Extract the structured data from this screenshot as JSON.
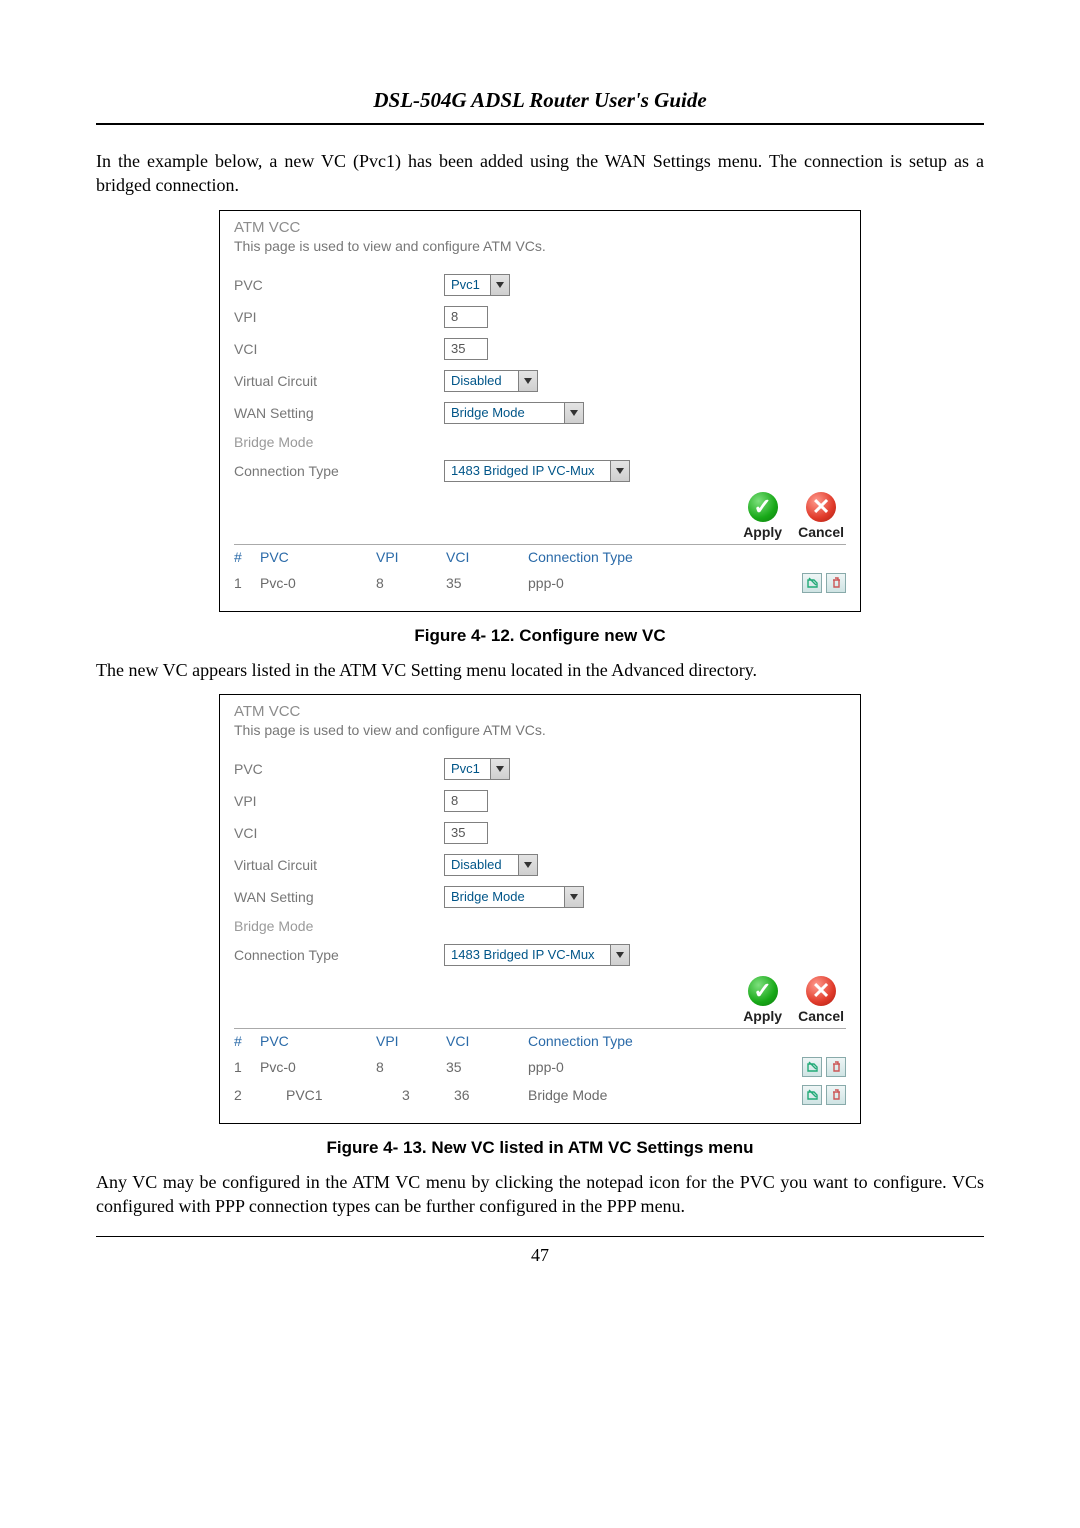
{
  "header": {
    "title": "DSL-504G ADSL Router User's Guide"
  },
  "para1": "In the example below, a new VC (Pvc1) has been added using the WAN Settings menu. The connection is setup as a bridged connection.",
  "fig1": {
    "title": "ATM VCC",
    "desc": "This page is used to view and configure ATM VCs.",
    "labels": {
      "pvc": "PVC",
      "vpi": "VPI",
      "vci": "VCI",
      "vcircuit": "Virtual Circuit",
      "wan": "WAN Setting",
      "section": "Bridge Mode",
      "ctype": "Connection Type"
    },
    "values": {
      "pvc": "Pvc1",
      "vpi": "8",
      "vci": "35",
      "vcircuit": "Disabled",
      "wan": "Bridge Mode",
      "ctype": "1483 Bridged IP VC-Mux"
    },
    "actions": {
      "apply": "Apply",
      "cancel": "Cancel"
    },
    "table": {
      "headers": {
        "num": "#",
        "pvc": "PVC",
        "vpi": "VPI",
        "vci": "VCI",
        "ctype": "Connection Type"
      },
      "rows": [
        {
          "num": "1",
          "pvc": "Pvc-0",
          "vpi": "8",
          "vci": "35",
          "ctype": "ppp-0"
        }
      ]
    },
    "caption": "Figure 4- 12. Configure new VC"
  },
  "para2": "The new VC appears listed in the ATM VC Setting menu located in the Advanced directory.",
  "fig2": {
    "title": "ATM VCC",
    "desc": "This page is used to view and configure ATM VCs.",
    "labels": {
      "pvc": "PVC",
      "vpi": "VPI",
      "vci": "VCI",
      "vcircuit": "Virtual Circuit",
      "wan": "WAN Setting",
      "section": "Bridge Mode",
      "ctype": "Connection Type"
    },
    "values": {
      "pvc": "Pvc1",
      "vpi": "8",
      "vci": "35",
      "vcircuit": "Disabled",
      "wan": "Bridge Mode",
      "ctype": "1483 Bridged IP VC-Mux"
    },
    "actions": {
      "apply": "Apply",
      "cancel": "Cancel"
    },
    "table": {
      "headers": {
        "num": "#",
        "pvc": "PVC",
        "vpi": "VPI",
        "vci": "VCI",
        "ctype": "Connection Type"
      },
      "rows": [
        {
          "num": "1",
          "pvc": "Pvc-0",
          "vpi": "8",
          "vci": "35",
          "ctype": "ppp-0"
        },
        {
          "num": "2",
          "pvc": "PVC1",
          "vpi": "3",
          "vci": "36",
          "ctype": "Bridge Mode"
        }
      ]
    },
    "caption": "Figure 4- 13. New VC listed in ATM VC Settings menu"
  },
  "para3": "Any VC may be configured in the ATM VC menu by clicking the notepad icon for the PVC you want to configure. VCs configured with PPP connection types can be further configured in the PPP menu.",
  "page_number": "47"
}
